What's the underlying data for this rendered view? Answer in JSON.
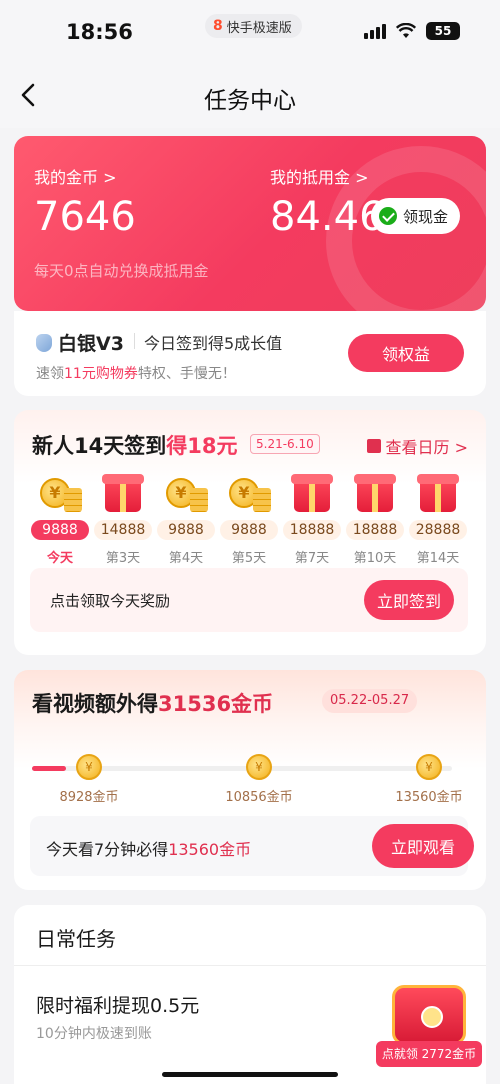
{
  "status_bar": {
    "time": "18:56",
    "app_badge": "快手极速版",
    "battery": "55"
  },
  "nav": {
    "title": "任务中心"
  },
  "coins": {
    "coins_label": "我的金币 >",
    "coins_value": "7646",
    "voucher_label": "我的抵用金 >",
    "voucher_value": "84.46",
    "withdraw_label": "领现金",
    "hint": "每天0点自动兑换成抵用金"
  },
  "vip": {
    "level": "白银V3",
    "tip": "今日签到得5成长值",
    "sub_prefix": "速领",
    "sub_highlight": "11元购物券",
    "sub_suffix": "特权、手慢无！",
    "button": "领权益"
  },
  "signin": {
    "title_prefix": "新人14天签到",
    "title_highlight": "得18元",
    "date_range": "5.21-6.10",
    "calendar_link": "查看日历 >",
    "days": [
      {
        "amount": "9888",
        "label": "今天",
        "icon": "coin-stack-icon"
      },
      {
        "amount": "14888",
        "label": "第3天",
        "icon": "gift-box-icon"
      },
      {
        "amount": "9888",
        "label": "第4天",
        "icon": "coin-stack-icon"
      },
      {
        "amount": "9888",
        "label": "第5天",
        "icon": "coin-stack-icon"
      },
      {
        "amount": "18888",
        "label": "第7天",
        "icon": "gift-box-icon"
      },
      {
        "amount": "18888",
        "label": "第10天",
        "icon": "gift-box-icon"
      },
      {
        "amount": "28888",
        "label": "第14天",
        "icon": "gift-box-icon"
      }
    ],
    "claim_text": "点击领取今天奖励",
    "claim_button": "立即签到"
  },
  "video": {
    "title_prefix": "看视频额外得",
    "title_highlight": "31536金币",
    "date_range": "05.22-05.27",
    "progress": 0.08,
    "milestones": [
      {
        "label": "8928金币",
        "icon_glyph": "¥"
      },
      {
        "label": "10856金币",
        "icon_glyph": "¥"
      },
      {
        "label": "13560金币",
        "icon_glyph": "¥"
      }
    ],
    "watch_prefix": "今天看7分钟必得",
    "watch_highlight": "13560金币",
    "watch_button": "立即观看"
  },
  "daily": {
    "title": "日常任务",
    "task_title": "限时福利提现0.5元",
    "task_sub": "10分钟内极速到账",
    "reward_tag": "点就领 2772金币"
  },
  "colors": {
    "accent": "#f43b5f",
    "card_gradient_start": "#ff5a6f",
    "background": "#f4f4f6"
  }
}
